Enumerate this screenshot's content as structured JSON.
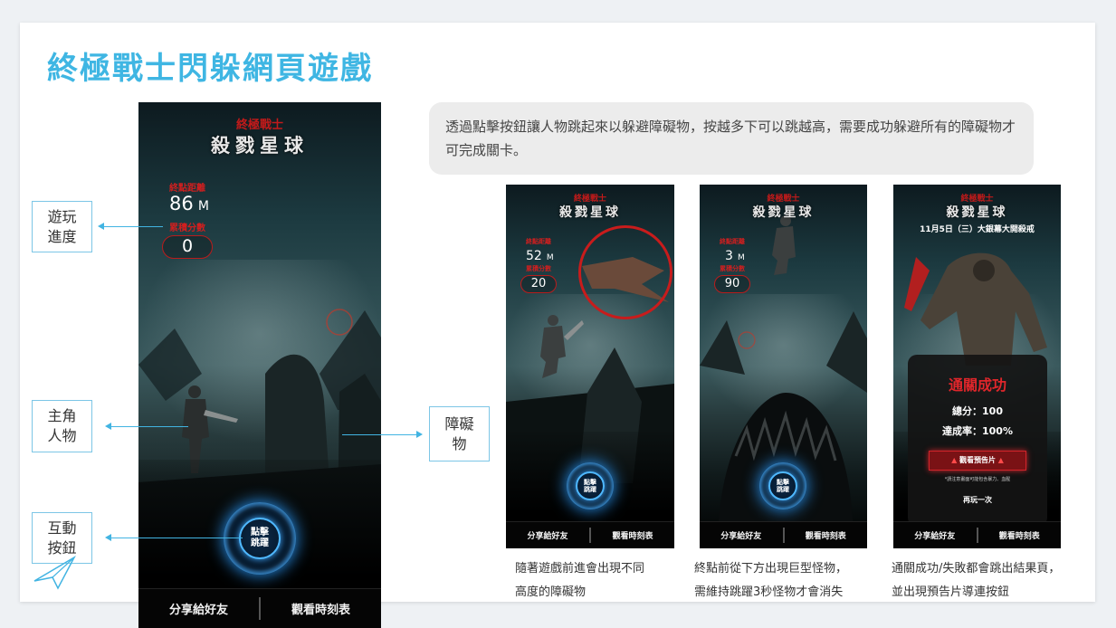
{
  "title": "終極戰士閃躲網頁遊戲",
  "description": "透過點擊按鈕讓人物跳起來以躲避障礙物，按越多下可以跳越高，需要成功躲避所有的障礙物才可完成關卡。",
  "labels": {
    "progress": "遊玩進度",
    "character": "主角人物",
    "button": "互動按鈕",
    "obstacle": "障礙物"
  },
  "game": {
    "logo_small": "終極戰士",
    "logo_big": "殺戮星球",
    "distance_label": "終點距離",
    "score_label": "累積分數",
    "jump_button": "點擊跳躍",
    "share": "分享給好友",
    "showtimes": "觀看時刻表"
  },
  "main_screen": {
    "distance": "86",
    "unit": "M",
    "score": "0"
  },
  "screen2": {
    "distance": "52",
    "unit": "M",
    "score": "20"
  },
  "screen3": {
    "distance": "3",
    "unit": "M",
    "score": "90"
  },
  "screen4": {
    "release": "11月5日（三）大銀幕大開殺戒",
    "result_title": "通關成功",
    "total_score": "總分：100",
    "rate": "達成率：100%",
    "trailer": "觀看預告片",
    "note": "*請注意畫面可能包含暴力、血腥",
    "retry": "再玩一次"
  },
  "captions": {
    "c1_line1": "隨著遊戲前進會出現不同",
    "c1_line2": "高度的障礙物",
    "c2_line1": "終點前從下方出現巨型怪物，",
    "c2_line2": "需維持跳躍3秒怪物才會消失",
    "c3_line1": "通關成功/失敗都會跳出結果頁，",
    "c3_line2": "並出現預告片導連按鈕"
  },
  "colors": {
    "accent": "#3fb6e3",
    "brand_red": "#c21a1a",
    "button_glow": "#2a9cff"
  }
}
